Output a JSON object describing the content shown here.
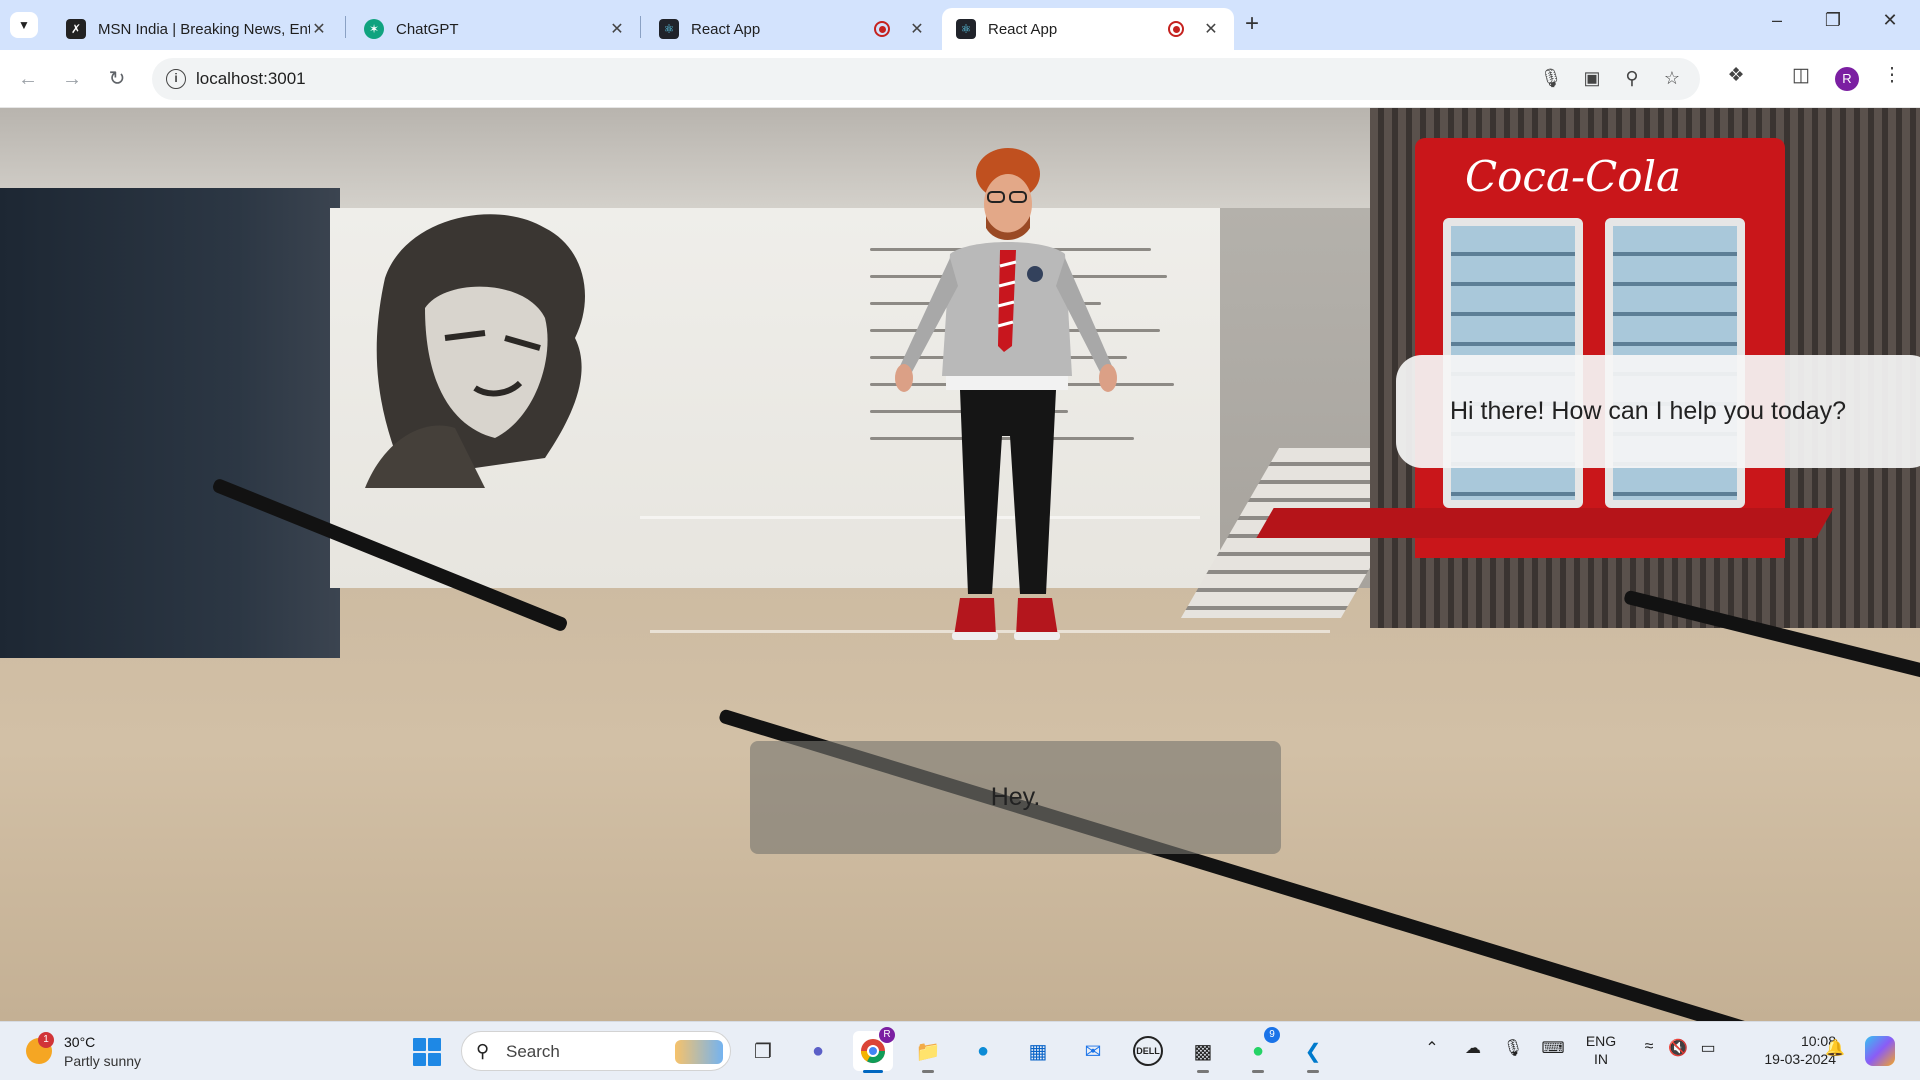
{
  "browser": {
    "tabs": [
      {
        "title": "MSN India | Breaking News, Ent",
        "favicon": "msn-icon",
        "active": false,
        "recording": false
      },
      {
        "title": "ChatGPT",
        "favicon": "chatgpt-icon",
        "active": false,
        "recording": false
      },
      {
        "title": "React App",
        "favicon": "react-icon",
        "active": false,
        "recording": true
      },
      {
        "title": "React App",
        "favicon": "react-icon",
        "active": true,
        "recording": true
      }
    ],
    "url": "localhost:3001",
    "profile_initial": "R"
  },
  "scene": {
    "mural_brand": "Coca-Cola"
  },
  "chat": {
    "assistant_message": "Hi there! How can I help you today?",
    "user_message": "Hey."
  },
  "taskbar": {
    "weather": {
      "temperature": "30°C",
      "condition": "Partly sunny",
      "alert_count": "1"
    },
    "search_placeholder": "Search",
    "apps": [
      {
        "name": "task-view-icon"
      },
      {
        "name": "teams-meet-icon"
      },
      {
        "name": "chrome-icon",
        "badge": "R"
      },
      {
        "name": "file-explorer-icon"
      },
      {
        "name": "edge-icon"
      },
      {
        "name": "microsoft-store-icon"
      },
      {
        "name": "mail-icon"
      },
      {
        "name": "dell-icon"
      },
      {
        "name": "terminal-icon"
      },
      {
        "name": "whatsapp-icon",
        "badge": "9"
      },
      {
        "name": "vscode-icon"
      }
    ],
    "language": {
      "line1": "ENG",
      "line2": "IN"
    },
    "time": "10:08",
    "date": "19-03-2024"
  },
  "colors": {
    "tabstrip": "#d3e3fd",
    "record_red": "#c5221f",
    "profile": "#7b1fa2",
    "fridge_red": "#c9161a"
  }
}
